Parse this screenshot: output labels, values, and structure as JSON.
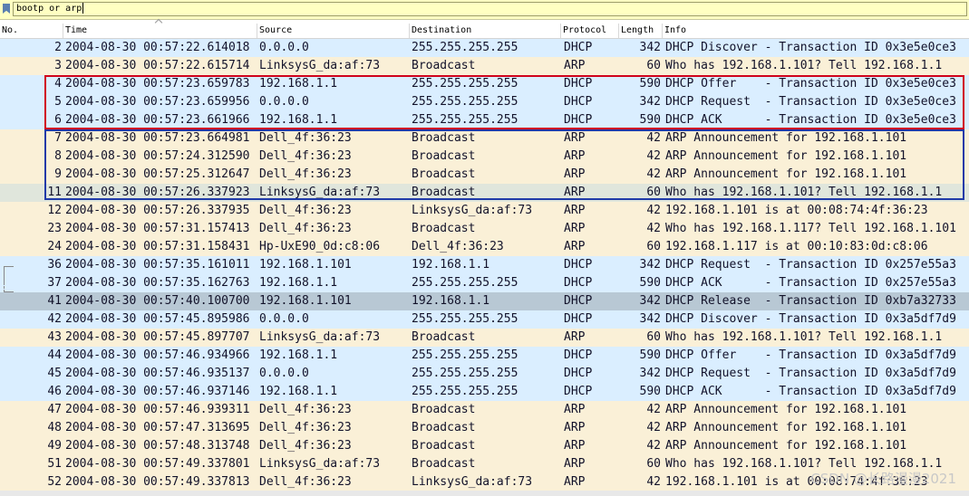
{
  "filter": {
    "value": "bootp or arp",
    "accent": "#ffffc2"
  },
  "columns": [
    "No.",
    "Time",
    "Source",
    "Destination",
    "Protocol",
    "Length",
    "Info"
  ],
  "colors": {
    "dhcp": "#daeeff",
    "arp": "#faf0d7",
    "selected_gray": "#e0e6dc",
    "release": "#b8c8d4",
    "red_box": "#d0021b",
    "blue_box": "#1f3aa8"
  },
  "rows": [
    {
      "no": "2",
      "time": "2004-08-30 00:57:22.614018",
      "src": "0.0.0.0",
      "dst": "255.255.255.255",
      "proto": "DHCP",
      "len": "342",
      "info": "DHCP Discover - Transaction ID 0x3e5e0ce3",
      "style": "dhcp"
    },
    {
      "no": "3",
      "time": "2004-08-30 00:57:22.615714",
      "src": "LinksysG_da:af:73",
      "dst": "Broadcast",
      "proto": "ARP",
      "len": "60",
      "info": "Who has 192.168.1.101? Tell 192.168.1.1",
      "style": "arp"
    },
    {
      "no": "4",
      "time": "2004-08-30 00:57:23.659783",
      "src": "192.168.1.1",
      "dst": "255.255.255.255",
      "proto": "DHCP",
      "len": "590",
      "info": "DHCP Offer    - Transaction ID 0x3e5e0ce3",
      "style": "dhcp"
    },
    {
      "no": "5",
      "time": "2004-08-30 00:57:23.659956",
      "src": "0.0.0.0",
      "dst": "255.255.255.255",
      "proto": "DHCP",
      "len": "342",
      "info": "DHCP Request  - Transaction ID 0x3e5e0ce3",
      "style": "dhcp"
    },
    {
      "no": "6",
      "time": "2004-08-30 00:57:23.661966",
      "src": "192.168.1.1",
      "dst": "255.255.255.255",
      "proto": "DHCP",
      "len": "590",
      "info": "DHCP ACK      - Transaction ID 0x3e5e0ce3",
      "style": "dhcp"
    },
    {
      "no": "7",
      "time": "2004-08-30 00:57:23.664981",
      "src": "Dell_4f:36:23",
      "dst": "Broadcast",
      "proto": "ARP",
      "len": "42",
      "info": "ARP Announcement for 192.168.1.101",
      "style": "arp"
    },
    {
      "no": "8",
      "time": "2004-08-30 00:57:24.312590",
      "src": "Dell_4f:36:23",
      "dst": "Broadcast",
      "proto": "ARP",
      "len": "42",
      "info": "ARP Announcement for 192.168.1.101",
      "style": "arp"
    },
    {
      "no": "9",
      "time": "2004-08-30 00:57:25.312647",
      "src": "Dell_4f:36:23",
      "dst": "Broadcast",
      "proto": "ARP",
      "len": "42",
      "info": "ARP Announcement for 192.168.1.101",
      "style": "arp"
    },
    {
      "no": "11",
      "time": "2004-08-30 00:57:26.337923",
      "src": "LinksysG_da:af:73",
      "dst": "Broadcast",
      "proto": "ARP",
      "len": "60",
      "info": "Who has 192.168.1.101? Tell 192.168.1.1",
      "style": "selected"
    },
    {
      "no": "12",
      "time": "2004-08-30 00:57:26.337935",
      "src": "Dell_4f:36:23",
      "dst": "LinksysG_da:af:73",
      "proto": "ARP",
      "len": "42",
      "info": "192.168.1.101 is at 00:08:74:4f:36:23",
      "style": "arp"
    },
    {
      "no": "23",
      "time": "2004-08-30 00:57:31.157413",
      "src": "Dell_4f:36:23",
      "dst": "Broadcast",
      "proto": "ARP",
      "len": "42",
      "info": "Who has 192.168.1.117? Tell 192.168.1.101",
      "style": "arp"
    },
    {
      "no": "24",
      "time": "2004-08-30 00:57:31.158431",
      "src": "Hp-UxE90_0d:c8:06",
      "dst": "Dell_4f:36:23",
      "proto": "ARP",
      "len": "60",
      "info": "192.168.1.117 is at 00:10:83:0d:c8:06",
      "style": "arp"
    },
    {
      "no": "36",
      "time": "2004-08-30 00:57:35.161011",
      "src": "192.168.1.101",
      "dst": "192.168.1.1",
      "proto": "DHCP",
      "len": "342",
      "info": "DHCP Request  - Transaction ID 0x257e55a3",
      "style": "dhcp"
    },
    {
      "no": "37",
      "time": "2004-08-30 00:57:35.162763",
      "src": "192.168.1.1",
      "dst": "255.255.255.255",
      "proto": "DHCP",
      "len": "590",
      "info": "DHCP ACK      - Transaction ID 0x257e55a3",
      "style": "dhcp"
    },
    {
      "no": "41",
      "time": "2004-08-30 00:57:40.100700",
      "src": "192.168.1.101",
      "dst": "192.168.1.1",
      "proto": "DHCP",
      "len": "342",
      "info": "DHCP Release  - Transaction ID 0xb7a32733",
      "style": "release"
    },
    {
      "no": "42",
      "time": "2004-08-30 00:57:45.895986",
      "src": "0.0.0.0",
      "dst": "255.255.255.255",
      "proto": "DHCP",
      "len": "342",
      "info": "DHCP Discover - Transaction ID 0x3a5df7d9",
      "style": "dhcp"
    },
    {
      "no": "43",
      "time": "2004-08-30 00:57:45.897707",
      "src": "LinksysG_da:af:73",
      "dst": "Broadcast",
      "proto": "ARP",
      "len": "60",
      "info": "Who has 192.168.1.101? Tell 192.168.1.1",
      "style": "arp"
    },
    {
      "no": "44",
      "time": "2004-08-30 00:57:46.934966",
      "src": "192.168.1.1",
      "dst": "255.255.255.255",
      "proto": "DHCP",
      "len": "590",
      "info": "DHCP Offer    - Transaction ID 0x3a5df7d9",
      "style": "dhcp"
    },
    {
      "no": "45",
      "time": "2004-08-30 00:57:46.935137",
      "src": "0.0.0.0",
      "dst": "255.255.255.255",
      "proto": "DHCP",
      "len": "342",
      "info": "DHCP Request  - Transaction ID 0x3a5df7d9",
      "style": "dhcp"
    },
    {
      "no": "46",
      "time": "2004-08-30 00:57:46.937146",
      "src": "192.168.1.1",
      "dst": "255.255.255.255",
      "proto": "DHCP",
      "len": "590",
      "info": "DHCP ACK      - Transaction ID 0x3a5df7d9",
      "style": "dhcp"
    },
    {
      "no": "47",
      "time": "2004-08-30 00:57:46.939311",
      "src": "Dell_4f:36:23",
      "dst": "Broadcast",
      "proto": "ARP",
      "len": "42",
      "info": "ARP Announcement for 192.168.1.101",
      "style": "arp"
    },
    {
      "no": "48",
      "time": "2004-08-30 00:57:47.313695",
      "src": "Dell_4f:36:23",
      "dst": "Broadcast",
      "proto": "ARP",
      "len": "42",
      "info": "ARP Announcement for 192.168.1.101",
      "style": "arp"
    },
    {
      "no": "49",
      "time": "2004-08-30 00:57:48.313748",
      "src": "Dell_4f:36:23",
      "dst": "Broadcast",
      "proto": "ARP",
      "len": "42",
      "info": "ARP Announcement for 192.168.1.101",
      "style": "arp"
    },
    {
      "no": "51",
      "time": "2004-08-30 00:57:49.337801",
      "src": "LinksysG_da:af:73",
      "dst": "Broadcast",
      "proto": "ARP",
      "len": "60",
      "info": "Who has 192.168.1.101? Tell 192.168.1.1",
      "style": "arp"
    },
    {
      "no": "52",
      "time": "2004-08-30 00:57:49.337813",
      "src": "Dell_4f:36:23",
      "dst": "LinksysG_da:af:73",
      "proto": "ARP",
      "len": "42",
      "info": "192.168.1.101 is at 00:08:74:4f:36:23",
      "style": "arp"
    }
  ],
  "watermark": "CSDN @长路漫漫2021"
}
